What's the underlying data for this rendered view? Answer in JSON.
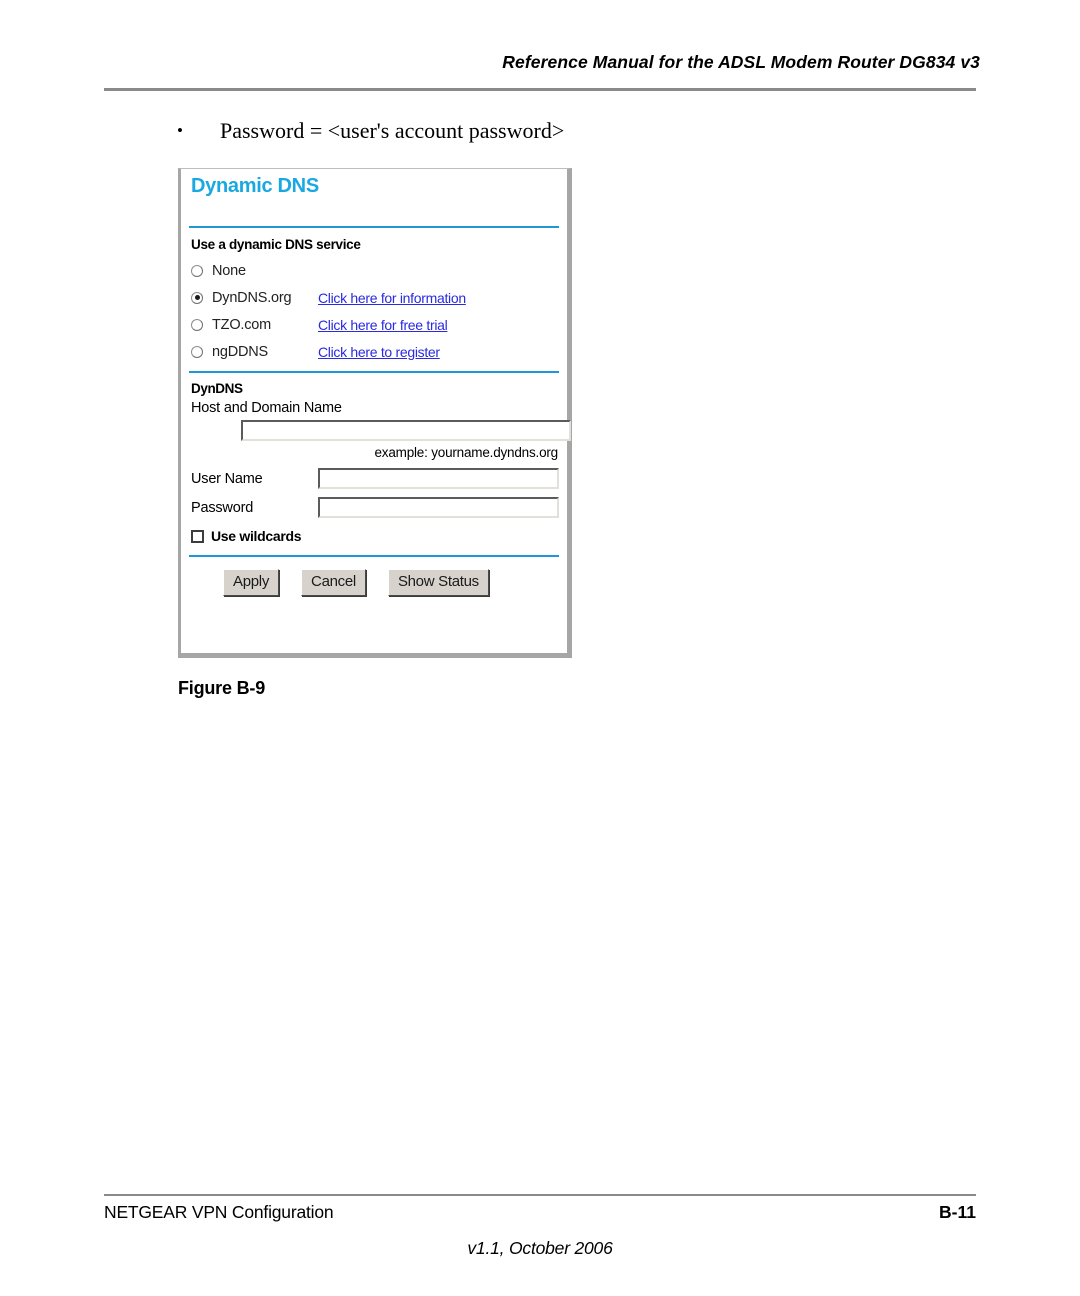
{
  "page": {
    "header_title": "Reference Manual for the ADSL Modem Router DG834 v3",
    "bullet_text": "Password = <user's account password>",
    "bullet_marker": "•",
    "figure_caption": "Figure B-9"
  },
  "panel": {
    "title": "Dynamic DNS",
    "service_section_heading": "Use a dynamic DNS service",
    "radios": [
      {
        "label": "None",
        "selected": false,
        "link": ""
      },
      {
        "label": "DynDNS.org",
        "selected": true,
        "link": "Click here for information"
      },
      {
        "label": "TZO.com",
        "selected": false,
        "link": "Click here for free trial"
      },
      {
        "label": "ngDDNS",
        "selected": false,
        "link": "Click here to register"
      }
    ],
    "form": {
      "heading": "DynDNS",
      "host_label": "Host and Domain Name",
      "host_value": "",
      "host_example": "example:  yourname.dyndns.org",
      "username_label": "User Name",
      "username_value": "",
      "password_label": "Password",
      "password_value": "",
      "wildcards_label": "Use wildcards",
      "wildcards_checked": false
    },
    "buttons": {
      "apply": "Apply",
      "cancel": "Cancel",
      "show_status": "Show Status"
    },
    "colors": {
      "title_blue": "#1aa8e2",
      "rule_blue": "#2196d6",
      "link_blue": "#2a2ae0",
      "button_face": "#d7d3cc"
    }
  },
  "footer": {
    "left": "NETGEAR VPN Configuration",
    "right": "B-11",
    "version": "v1.1, October 2006"
  }
}
